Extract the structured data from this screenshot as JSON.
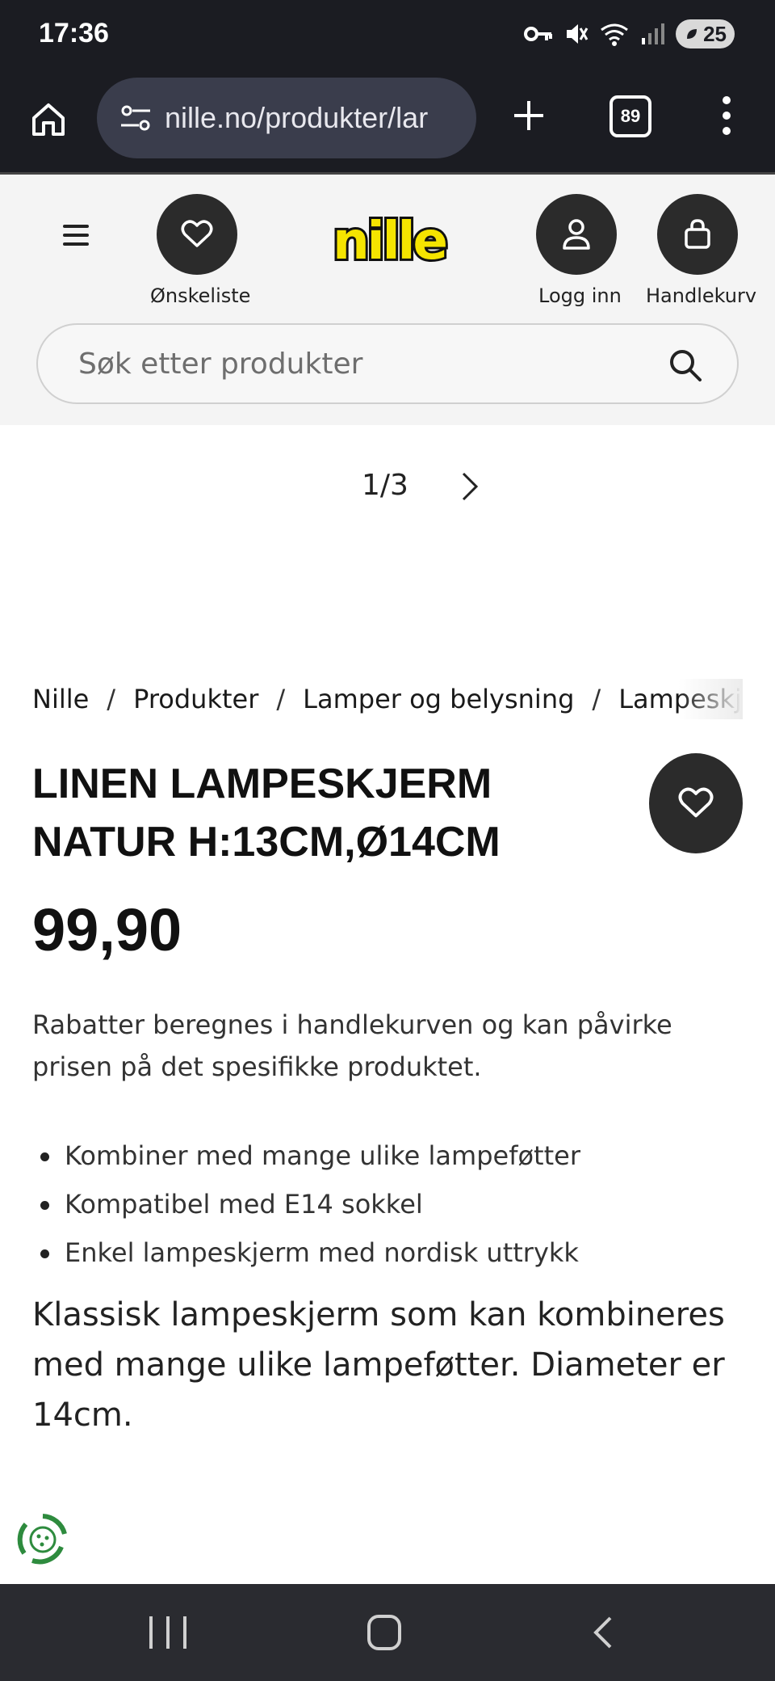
{
  "status_bar": {
    "time": "17:36",
    "battery": "25",
    "icons": [
      "key-icon",
      "mute-icon",
      "wifi-icon",
      "signal-icon",
      "battery-icon"
    ]
  },
  "browser": {
    "url": "nille.no/produkter/lar",
    "tab_count": "89"
  },
  "header": {
    "wishlist_label": "Ønskeliste",
    "login_label": "Logg inn",
    "cart_label": "Handlekurv",
    "logo_text": "nille",
    "brand_color": "#f5e400",
    "search_placeholder": "Søk etter produkter"
  },
  "carousel": {
    "pager": "1/3"
  },
  "breadcrumb": [
    "Nille",
    "Produkter",
    "Lamper og belysning",
    "Lampeskje"
  ],
  "product": {
    "title": "LINEN LAMPESKJERM NATUR H:13CM,Ø14CM",
    "price": "99,90",
    "discount_note": "Rabatter beregnes i handlekurven og kan påvirke prisen på det spesifikke produktet.",
    "features": [
      "Kombiner med mange ulike lampeføtter",
      "Kompatibel med E14 sokkel",
      "Enkel lampeskjerm med nordisk uttrykk"
    ],
    "description": "Klassisk lampeskjerm som kan kombineres med mange ulike lampeføtter. Diameter er 14cm."
  }
}
